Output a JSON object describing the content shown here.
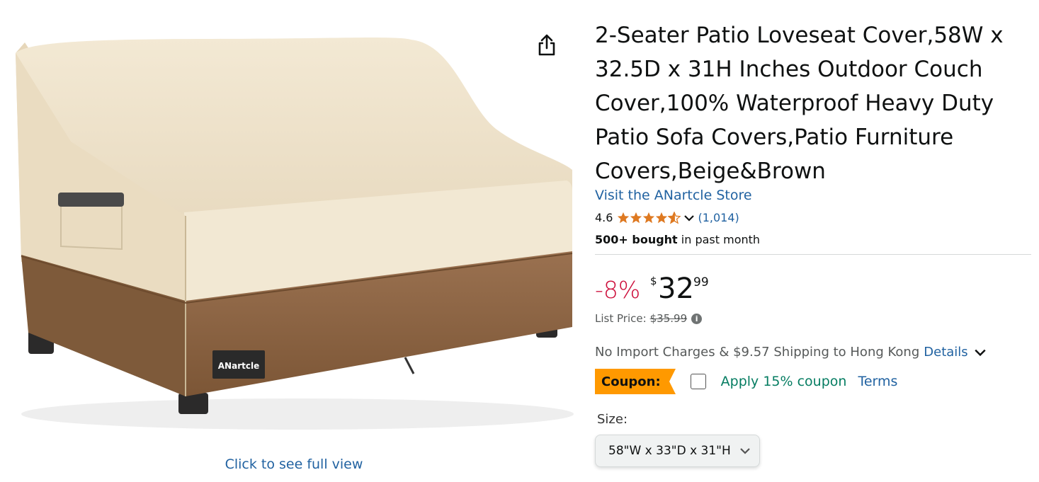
{
  "gallery": {
    "brand_on_cover": "ANartcle",
    "full_view_link": "Click to see full view",
    "share_icon": "share-icon"
  },
  "product": {
    "title": "2-Seater Patio Loveseat Cover,58W x 32.5D x 31H Inches Outdoor Couch Cover,100% Waterproof Heavy Duty Patio Sofa Covers,Patio Furniture Covers,Beige&Brown",
    "store_link": "Visit the ANartcle Store",
    "rating_value": "4.6",
    "rating_stars": 4.6,
    "rating_count": "(1,014)",
    "bought_bold": "500+ bought",
    "bought_rest": "in past month"
  },
  "price": {
    "discount": "-8%",
    "currency": "$",
    "whole": "32",
    "fraction": "99",
    "list_label": "List Price:",
    "list_value": "$35.99",
    "info_icon": "i"
  },
  "shipping": {
    "text": "No Import Charges & $9.57 Shipping to Hong Kong",
    "details_link": "Details"
  },
  "coupon": {
    "tag": "Coupon:",
    "apply_text": "Apply 15% coupon",
    "terms_link": "Terms"
  },
  "size": {
    "label": "Size:",
    "selected": "58\"W x 33\"D x 31\"H"
  },
  "colors": {
    "link": "#2162a1",
    "discount": "#cc0c39",
    "star": "#de7921",
    "coupon_bg": "#ff9900",
    "coupon_text": "#067d62",
    "cover_beige": "#ede0c6",
    "cover_brown": "#8c6544"
  }
}
